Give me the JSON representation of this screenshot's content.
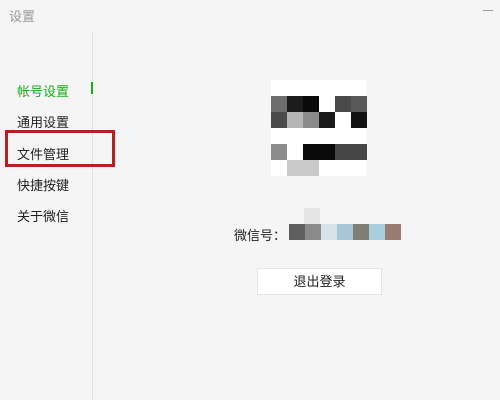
{
  "window": {
    "title": "设置"
  },
  "sidebar": {
    "items": [
      {
        "label": "帐号设置",
        "active": true
      },
      {
        "label": "通用设置",
        "active": false
      },
      {
        "label": "文件管理",
        "active": false,
        "highlighted": true
      },
      {
        "label": "快捷按键",
        "active": false
      },
      {
        "label": "关于微信",
        "active": false
      }
    ]
  },
  "account": {
    "wechat_id_label": "微信号：",
    "wechat_id_obscured": true,
    "logout_label": "退出登录"
  },
  "colors": {
    "accent": "#1aad19",
    "highlight_border": "#b22222",
    "background": "#f5f5f5"
  }
}
